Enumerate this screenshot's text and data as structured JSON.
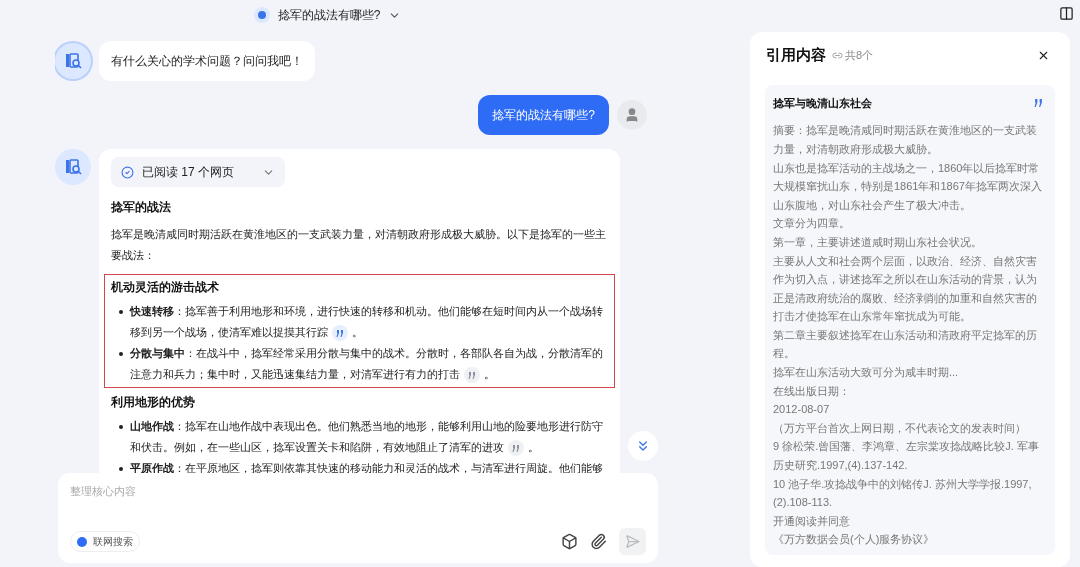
{
  "header": {
    "title": "捻军的战法有哪些?"
  },
  "messages": [
    {
      "kind": "bot",
      "text": "有什么关心的学术问题？问问我吧！"
    },
    {
      "kind": "user",
      "text": "捻军的战法有哪些?"
    },
    {
      "kind": "answer",
      "reading": "已阅读 17 个网页",
      "expanded": false,
      "title": "捻军的战法",
      "intro": "捻军是晚清咸同时期活跃在黄淮地区的一支武装力量，对清朝政府形成极大威胁。以下是捻军的一些主要战法：",
      "sections": [
        {
          "heading": "机动灵活的游击战术",
          "highlighted": true,
          "items": [
            {
              "term": "快速转移",
              "text": "：捻军善于利用地形和环境，进行快速的转移和机动。他们能够在短时间内从一个战场转移到另一个战场，使清军难以捉摸其行踪",
              "cite_active": true,
              "end": "。"
            },
            {
              "term": "分散与集中",
              "text": "：在战斗中，捻军经常采用分散与集中的战术。分散时，各部队各自为战，分散清军的注意力和兵力；集中时，又能迅速集结力量，对清军进行有力的打击",
              "cite_active": false,
              "end": "。"
            }
          ]
        },
        {
          "heading": "利用地形的优势",
          "highlighted": false,
          "items": [
            {
              "term": "山地作战",
              "text": "：捻军在山地作战中表现出色。他们熟悉当地的地形，能够利用山地的险要地形进行防守和伏击。例如，在一些山区，捻军设置关卡和陷阱，有效地阻止了清军的进攻",
              "cite_active": false,
              "end": "。"
            },
            {
              "term": "平原作战",
              "text": "：在平原地区，捻军则依靠其快速的移动能力和灵活的战术，与清军进行周旋。他们能够"
            }
          ]
        }
      ]
    }
  ],
  "input": {
    "placeholder": "整理核心内容",
    "web_search": {
      "label": "联网搜索",
      "on": true
    }
  },
  "panel": {
    "title": "引用内容",
    "count": "共8个",
    "card": {
      "title": "捻军与晚清山东社会",
      "paragraphs": [
        "摘要：捻军是晚清咸同时期活跃在黄淮地区的一支武装力量，对清朝政府形成极大威胁。",
        "山东也是捻军活动的主战场之一，1860年以后捻军时常大规模窜扰山东，特别是1861年和1867年捻军两次深入山东腹地，对山东社会产生了极大冲击。",
        "文章分为四章。",
        "第一章，主要讲述道咸时期山东社会状况。",
        "主要从人文和社会两个层面，以政治、经济、自然灾害作为切入点，讲述捻军之所以在山东活动的背景，认为正是清政府统治的腐败、经济剥削的加重和自然灾害的打击才使捻军在山东常年窜扰成为可能。",
        "第二章主要叙述捻军在山东活动和清政府平定捻军的历程。",
        "捻军在山东活动大致可分为咸丰时期...",
        "在线出版日期：",
        "2012-08-07",
        "（万方平台首次上网日期，不代表论文的发表时间）",
        "9 徐松荣.曾国藩、李鸿章、左宗棠攻捻战略比较J. 军事历史研究.1997,(4).137-142.",
        "10 池子华.攻捻战争中的刘铭传J. 苏州大学学报.1997,(2).108-113.",
        "开通阅读并同意",
        "《万方数据会员(个人)服务协议》"
      ]
    }
  }
}
